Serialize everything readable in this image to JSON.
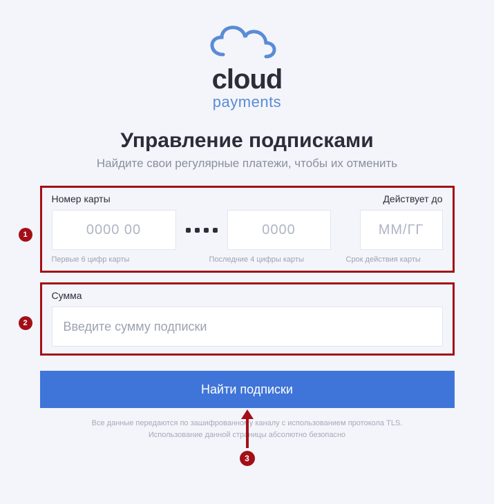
{
  "logo": {
    "top_text": "cloud",
    "bottom_text": "payments"
  },
  "heading": "Управление подписками",
  "subheading": "Найдите свои регулярные платежи, чтобы их отменить",
  "card_group": {
    "label_number": "Номер карты",
    "label_expiry": "Действует до",
    "placeholder_first6": "0000 00",
    "placeholder_last4": "0000",
    "placeholder_expiry": "ММ/ГГ",
    "hint_first6": "Первые 6 цифр карты",
    "hint_last4": "Последние 4 цифры карты",
    "hint_expiry": "Срок действия карты"
  },
  "amount_group": {
    "label": "Сумма",
    "placeholder": "Введите сумму подписки"
  },
  "submit_label": "Найти подписки",
  "footer_line1": "Все данные передаются по зашифрованному каналу с использованием протокола TLS.",
  "footer_line2": "Использование данной страницы абсолютно безопасно",
  "callouts": {
    "one": "1",
    "two": "2",
    "three": "3"
  }
}
